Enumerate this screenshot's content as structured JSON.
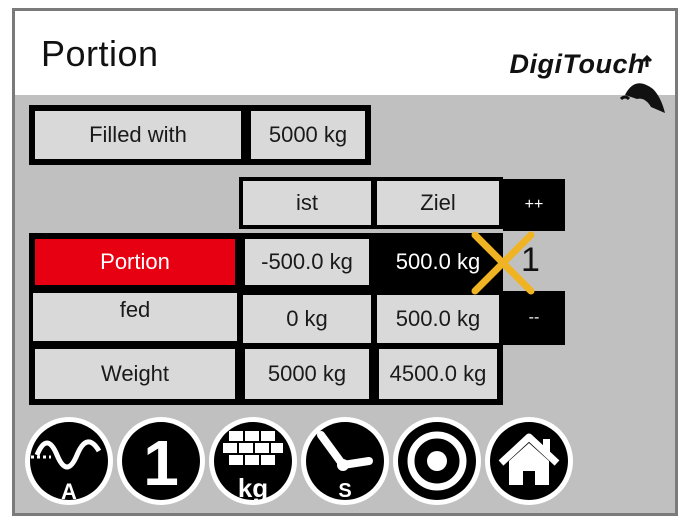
{
  "header": {
    "title": "Portion",
    "logo_text": "DigiTouch"
  },
  "filled": {
    "label": "Filled with",
    "value": "5000 kg"
  },
  "table": {
    "col_ist": "ist",
    "col_ziel": "Ziel",
    "plus_label": "++",
    "minus_label": "--",
    "portion_count": "1",
    "rows": [
      {
        "label": "Portion",
        "ist": "-500.0 kg",
        "ziel": "500.0 kg"
      },
      {
        "label": "fed",
        "ist": "0 kg",
        "ziel": "500.0 kg"
      },
      {
        "label": "Weight",
        "ist": "5000 kg",
        "ziel": "4500.0 kg"
      }
    ]
  },
  "icons": {
    "curve_letter": "A",
    "one_label": "1",
    "kg_label": "kg",
    "time_letter": "S"
  },
  "colors": {
    "accent_red": "#e60012",
    "cross_orange": "#f0b323",
    "panel_gray": "#c0c0c0"
  }
}
